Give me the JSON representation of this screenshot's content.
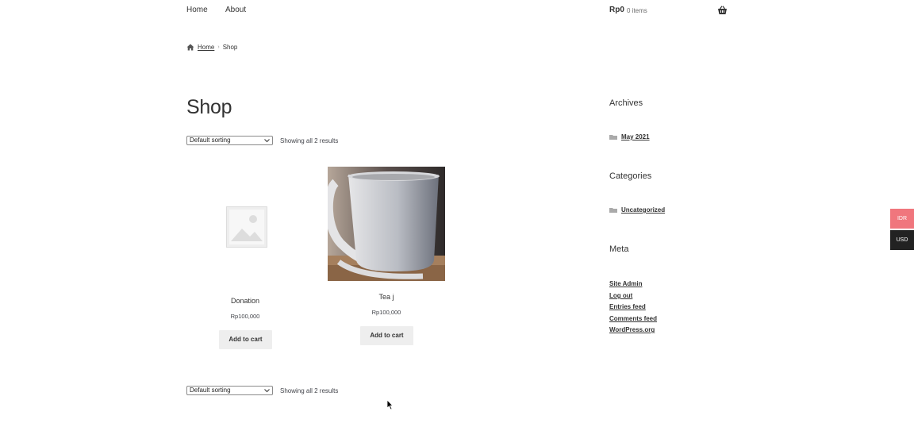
{
  "nav": {
    "home": "Home",
    "about": "About"
  },
  "cart": {
    "total": "Rp0",
    "count": "0 items",
    "icon": "basket-icon"
  },
  "breadcrumb": {
    "home": "Home",
    "current": "Shop",
    "icon": "home-icon"
  },
  "page": {
    "title": "Shop"
  },
  "sorting": {
    "selected": "Default sorting",
    "result_count": "Showing all 2 results"
  },
  "products": [
    {
      "title": "Donation",
      "price": "Rp100,000",
      "button": "Add to cart",
      "image": "placeholder-image-icon"
    },
    {
      "title": "Tea j",
      "price": "Rp100,000",
      "button": "Add to cart",
      "image": "mug-photo"
    }
  ],
  "sidebar": {
    "archives": {
      "title": "Archives",
      "items": [
        "May 2021"
      ]
    },
    "categories": {
      "title": "Categories",
      "items": [
        "Uncategorized"
      ]
    },
    "meta": {
      "title": "Meta",
      "items": [
        "Site Admin",
        "Log out",
        "Entries feed",
        "Comments feed",
        "WordPress.org"
      ]
    }
  },
  "currency_switcher": {
    "options": [
      "IDR",
      "USD"
    ],
    "active_color": "#f0767d",
    "inactive_color": "#222222"
  }
}
